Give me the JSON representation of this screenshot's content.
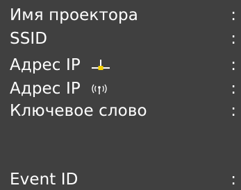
{
  "info_list": {
    "rows": [
      {
        "label": "Имя проектора",
        "colon": ":"
      },
      {
        "label": "SSID",
        "colon": ":"
      },
      {
        "label": "Адрес IP",
        "colon": ":",
        "icon": "wired-lan-icon"
      },
      {
        "label": "Адрес IP",
        "colon": ":",
        "icon": "wireless-lan-icon"
      },
      {
        "label": "Ключевое слово",
        "colon": ":"
      },
      {
        "label": "Event ID",
        "colon": ":"
      }
    ]
  },
  "colors": {
    "background": "#404040",
    "text": "#ffffff",
    "lan_icon_accent": "#f5d000"
  }
}
